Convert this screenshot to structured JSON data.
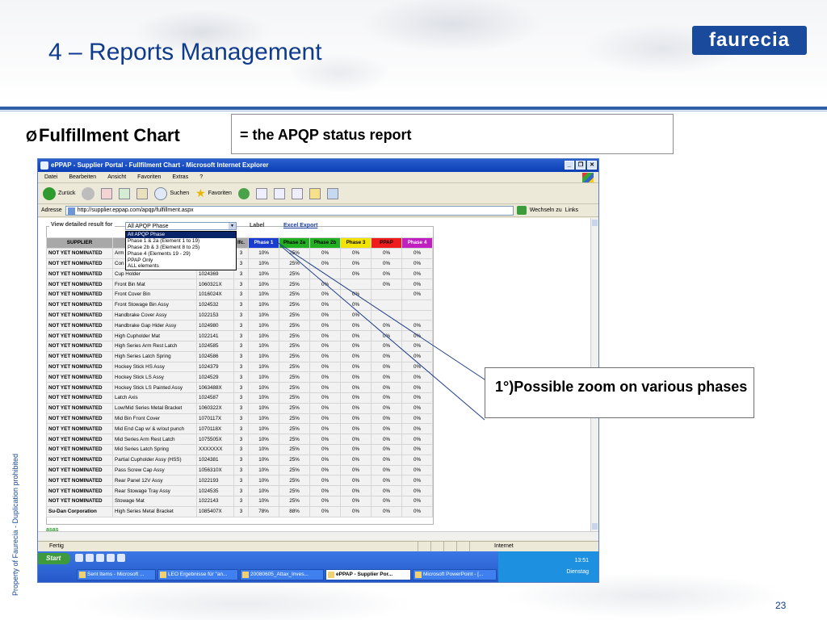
{
  "slide": {
    "title": "4 – Reports Management",
    "logo_text": "faurecia",
    "bullet_glyph": "Ø",
    "bullet_text": "Fulfillment Chart",
    "apqp_note": "= the APQP status report",
    "zoom_note": "1°)Possible zoom on various phases",
    "side_text": "Property of Faurecia - Duplication prohibited",
    "page_number": "23",
    "colors": {
      "title": "#0f3b8c",
      "rule": "#2e5fa8",
      "logo_bg": "#1a4a9c"
    }
  },
  "browser": {
    "window_title": "ePPAP - Supplier Portal - Fullfilment Chart - Microsoft Internet Explorer",
    "menu": [
      "Datei",
      "Bearbeiten",
      "Ansicht",
      "Favoriten",
      "Extras",
      "?"
    ],
    "toolbar": {
      "back": "Zurück",
      "search": "Suchen",
      "favorites": "Favoriten"
    },
    "address_label": "Adresse",
    "address_url": "http://supplier.eppap.com/apqp/fulfillment.aspx",
    "go_label": "Wechseln zu",
    "links_label": "Links",
    "status_text": "Fertig",
    "zone_text": "Internet"
  },
  "page": {
    "view_label": "View detailed result for",
    "selected_option": "All APQP Phase",
    "label_text": "Label",
    "excel_link": "Excel Export",
    "dropdown_options": [
      "All APQP Phase",
      "Phase 1 & 2a (Element 1 to 19)",
      "Phase 2b & 3 (Element 8 to 25)",
      "Phase 4 (Elements 19 - 29)",
      "PPAP Only",
      "ALL elements"
    ],
    "footer_link": "asas"
  },
  "table": {
    "headers": [
      "SUPPLIER",
      "",
      "",
      "lfc.",
      "Phase 1",
      "Phase 2a",
      "Phase 2b",
      "Phase 3",
      "PPAP",
      "Phase 4"
    ],
    "header_colors": {
      "Phase 1": "#1a3ccf",
      "Phase 2a": "#22b022",
      "Phase 2b": "#22b022",
      "Phase 3": "#f2e200",
      "PPAP": "#ee1c1c",
      "Phase 4": "#c020c0"
    },
    "rows": [
      [
        "NOT YET NOMINATED",
        "Arm",
        "",
        "3",
        "10%",
        "25%",
        "0%",
        "0%",
        "0%",
        "0%"
      ],
      [
        "NOT YET NOMINATED",
        "Con",
        "",
        "3",
        "10%",
        "25%",
        "0%",
        "0%",
        "0%",
        "0%"
      ],
      [
        "NOT YET NOMINATED",
        "Cup Holder",
        "1024369",
        "3",
        "10%",
        "25%",
        "",
        "0%",
        "0%",
        "0%"
      ],
      [
        "NOT YET NOMINATED",
        "Front Bin Mat",
        "1060321X",
        "3",
        "10%",
        "25%",
        "0%",
        "",
        "0%",
        "0%"
      ],
      [
        "NOT YET NOMINATED",
        "Front Cover Bin",
        "1016024X",
        "3",
        "10%",
        "25%",
        "0%",
        "0%",
        "",
        "0%"
      ],
      [
        "NOT YET NOMINATED",
        "Front Stowage Bin Assy",
        "1024532",
        "3",
        "10%",
        "25%",
        "0%",
        "0%",
        "",
        ""
      ],
      [
        "NOT YET NOMINATED",
        "Handbrake Cover Assy",
        "1022153",
        "3",
        "10%",
        "25%",
        "0%",
        "0%",
        "",
        ""
      ],
      [
        "NOT YET NOMINATED",
        "Handbrake Gap Hider Assy",
        "1024980",
        "3",
        "10%",
        "25%",
        "0%",
        "0%",
        "0%",
        "0%"
      ],
      [
        "NOT YET NOMINATED",
        "High Cupholder Mat",
        "1022141",
        "3",
        "10%",
        "25%",
        "0%",
        "0%",
        "0%",
        "0%"
      ],
      [
        "NOT YET NOMINATED",
        "High Series Arm Rest Latch",
        "1024585",
        "3",
        "10%",
        "25%",
        "0%",
        "0%",
        "0%",
        "0%"
      ],
      [
        "NOT YET NOMINATED",
        "High Series Latch Spring",
        "1024586",
        "3",
        "10%",
        "25%",
        "0%",
        "0%",
        "0%",
        "0%"
      ],
      [
        "NOT YET NOMINATED",
        "Hockey Stick HS Assy",
        "1024379",
        "3",
        "10%",
        "25%",
        "0%",
        "0%",
        "0%",
        "0%"
      ],
      [
        "NOT YET NOMINATED",
        "Hockey Stick LS Assy",
        "1024529",
        "3",
        "10%",
        "25%",
        "0%",
        "0%",
        "0%",
        "0%"
      ],
      [
        "NOT YET NOMINATED",
        "Hockey Stick LS Painted Assy",
        "1063488X",
        "3",
        "10%",
        "25%",
        "0%",
        "0%",
        "0%",
        "0%"
      ],
      [
        "NOT YET NOMINATED",
        "Latch Axis",
        "1024587",
        "3",
        "10%",
        "25%",
        "0%",
        "0%",
        "0%",
        "0%"
      ],
      [
        "NOT YET NOMINATED",
        "Low/Mid Series Metal Bracket",
        "1060322X",
        "3",
        "10%",
        "25%",
        "0%",
        "0%",
        "0%",
        "0%"
      ],
      [
        "NOT YET NOMINATED",
        "Mid Bin Front Cover",
        "1070117X",
        "3",
        "10%",
        "25%",
        "0%",
        "0%",
        "0%",
        "0%"
      ],
      [
        "NOT YET NOMINATED",
        "Mid End Cap w/ & w/out punch",
        "1070118X",
        "3",
        "10%",
        "25%",
        "0%",
        "0%",
        "0%",
        "0%"
      ],
      [
        "NOT YET NOMINATED",
        "Mid Series Arm Rest Latch",
        "1075505X",
        "3",
        "10%",
        "25%",
        "0%",
        "0%",
        "0%",
        "0%"
      ],
      [
        "NOT YET NOMINATED",
        "Mid Series Latch Spring",
        "XXXXXXX",
        "3",
        "10%",
        "25%",
        "0%",
        "0%",
        "0%",
        "0%"
      ],
      [
        "NOT YET NOMINATED",
        "Partial Cupholder Assy (HSS)",
        "1024381",
        "3",
        "10%",
        "25%",
        "0%",
        "0%",
        "0%",
        "0%"
      ],
      [
        "NOT YET NOMINATED",
        "Pass Screw Cap Assy",
        "1056310X",
        "3",
        "10%",
        "25%",
        "0%",
        "0%",
        "0%",
        "0%"
      ],
      [
        "NOT YET NOMINATED",
        "Rear Panel 12V Assy",
        "1022193",
        "3",
        "10%",
        "25%",
        "0%",
        "0%",
        "0%",
        "0%"
      ],
      [
        "NOT YET NOMINATED",
        "Rear Stowage Tray Assy",
        "1024535",
        "3",
        "10%",
        "25%",
        "0%",
        "0%",
        "0%",
        "0%"
      ],
      [
        "NOT YET NOMINATED",
        "Stowage Mat",
        "1022143",
        "3",
        "10%",
        "25%",
        "0%",
        "0%",
        "0%",
        "0%"
      ],
      [
        "Su-Dan Corporation",
        "High Series Metal Bracket",
        "1085407X",
        "3",
        "78%",
        "88%",
        "0%",
        "0%",
        "0%",
        "0%"
      ]
    ]
  },
  "taskbar": {
    "start_label": "Start",
    "tasks": [
      "Sent Items - Microsoft ...",
      "LEO Ergebnisse für \"an...",
      "20080605_Attax_Inves...",
      "ePPAP - Supplier Por...",
      "Microsoft PowerPoint - [..."
    ],
    "active_task": "ePPAP - Supplier Por...",
    "clock": "13:51",
    "day": "Dienstag"
  }
}
